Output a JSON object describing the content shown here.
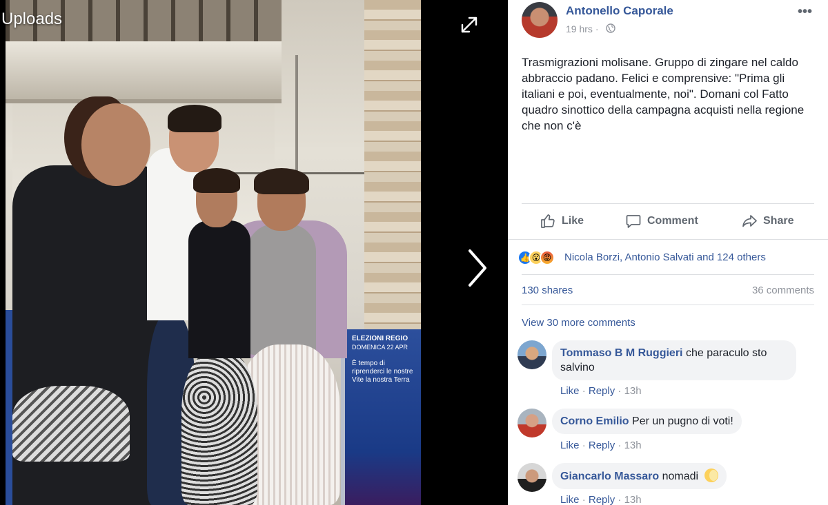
{
  "viewer": {
    "title": "Uploads",
    "poster_title": "ELEZIONI REGIO",
    "poster_date": "DOMENICA 22 APR",
    "poster_slogan": "È tempo di riprenderci le nostre Vite la nostra Terra"
  },
  "post": {
    "author": "Antonello Caporale",
    "time": "19 hrs",
    "time_separator": "·",
    "text": "Trasmigrazioni molisane. Gruppo di zingare nel caldo abbraccio padano. Felici e comprensive: \"Prima gli italiani e poi, eventualmente, noi\". Domani col Fatto quadro sinottico della campagna acquisti nella regione che non c'è",
    "more": "•••"
  },
  "actions": {
    "like": "Like",
    "comment": "Comment",
    "share": "Share"
  },
  "reactions": {
    "names": "Nicola Borzi, Antonio Salvati and 124 others",
    "shares": "130 shares",
    "comments": "36 comments"
  },
  "comments": {
    "view_more": "View 30 more comments",
    "like_label": "Like",
    "reply_label": "Reply",
    "separator": "·",
    "items": [
      {
        "name": "Tommaso B M Ruggieri",
        "text": "che paraculo sto salvino",
        "time": "13h"
      },
      {
        "name": "Corno Emilio",
        "text": "Per un pugno di voti!",
        "time": "13h"
      },
      {
        "name": "Giancarlo Massaro",
        "text": "nomadi",
        "time": "13h"
      }
    ]
  },
  "colors": {
    "link": "#365899",
    "muted": "#90949c",
    "text": "#1d2129",
    "bubble": "#f2f3f5"
  }
}
